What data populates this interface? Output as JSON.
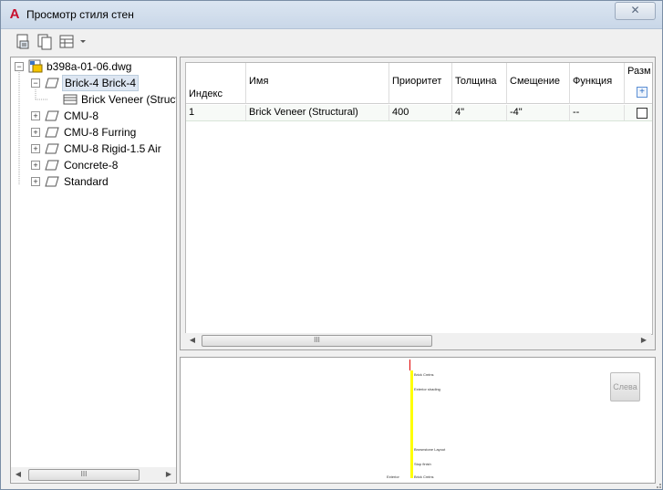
{
  "window": {
    "title": "Просмотр стиля стен",
    "close_label": "✕",
    "app_icon": "A",
    "accent": "#c8102e"
  },
  "toolbar": {
    "buttons": [
      {
        "icon": "open-drawing-icon"
      },
      {
        "icon": "copy-icon"
      },
      {
        "icon": "view-table-icon"
      }
    ]
  },
  "tree": {
    "root": "b398a-01-06.dwg",
    "items": [
      {
        "label": "Brick-4 Brick-4",
        "expanded": true,
        "selected": true
      },
      {
        "label": "Brick Veneer (Structural)",
        "child": true
      },
      {
        "label": "CMU-8"
      },
      {
        "label": "CMU-8 Furring"
      },
      {
        "label": "CMU-8 Rigid-1.5 Air"
      },
      {
        "label": "Concrete-8"
      },
      {
        "label": "Standard"
      }
    ],
    "scroll_grip": "III"
  },
  "grid": {
    "headers": [
      "Индекс",
      "Имя",
      "Приоритет",
      "Толщина",
      "Смещение",
      "Функция",
      "Разм"
    ],
    "rows": [
      {
        "index": "1",
        "name": "Brick Veneer (Structural)",
        "priority": "400",
        "thickness": "4\"",
        "offset": "-4\"",
        "function": "--"
      }
    ],
    "scroll_grip": "III"
  },
  "preview": {
    "labels": [
      "Brick Cmtns",
      "Exterior shading",
      "Brownstone Layout",
      "Stop finish",
      "Exterior",
      "Brick Cmtns"
    ],
    "left_button": "Слева",
    "layer_color": "#ffff00"
  }
}
